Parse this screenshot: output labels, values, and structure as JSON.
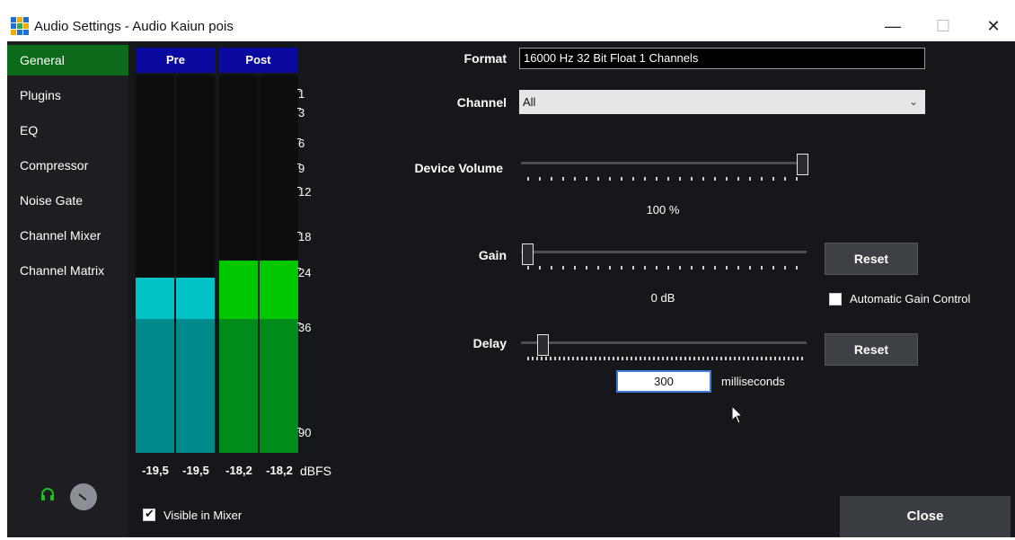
{
  "window": {
    "title": "Audio Settings - Audio Kaiun pois",
    "minimize_icon": "minimize-icon",
    "maximize_icon": "maximize-icon",
    "close_icon": "close-icon",
    "minimize_glyph": "—",
    "maximize_glyph": "☐",
    "close_glyph": "✕"
  },
  "sidebar": {
    "items": [
      {
        "label": "General",
        "active": true
      },
      {
        "label": "Plugins",
        "active": false
      },
      {
        "label": "EQ",
        "active": false
      },
      {
        "label": "Compressor",
        "active": false
      },
      {
        "label": "Noise Gate",
        "active": false
      },
      {
        "label": "Channel Mixer",
        "active": false
      },
      {
        "label": "Channel Matrix",
        "active": false
      }
    ]
  },
  "meters": {
    "pre_label": "Pre",
    "post_label": "Post",
    "channels": [
      {
        "group": "pre",
        "value": "-19,5"
      },
      {
        "group": "pre",
        "value": "-19,5"
      },
      {
        "group": "post",
        "value": "-18,2"
      },
      {
        "group": "post",
        "value": "-18,2"
      }
    ],
    "unit": "dBFS",
    "scale": [
      "1",
      "3",
      "6",
      "9",
      "12",
      "18",
      "24",
      "36",
      "90"
    ],
    "colors": {
      "pre_peak": "#00c2c4",
      "pre_level": "#008a8c",
      "post_peak": "#00c800",
      "post_level": "#008c1a",
      "header": "#0a0aa0"
    }
  },
  "settings": {
    "format_label": "Format",
    "format_value": "16000 Hz 32 Bit Float 1 Channels",
    "channel_label": "Channel",
    "channel_value": "All",
    "device_volume_label": "Device Volume",
    "device_volume_value": "100 %",
    "device_volume_fraction": 1.0,
    "gain_label": "Gain",
    "gain_value": "0 dB",
    "gain_fraction": 0.0,
    "gain_reset": "Reset",
    "agc_label": "Automatic Gain Control",
    "agc_checked": false,
    "delay_label": "Delay",
    "delay_value": "300",
    "delay_unit": "milliseconds",
    "delay_reset": "Reset"
  },
  "footer": {
    "visible_in_mixer_label": "Visible in Mixer",
    "visible_in_mixer_checked": true,
    "close_label": "Close"
  },
  "colors": {
    "accent_active": "#0c6b1a",
    "background": "#15171a"
  }
}
